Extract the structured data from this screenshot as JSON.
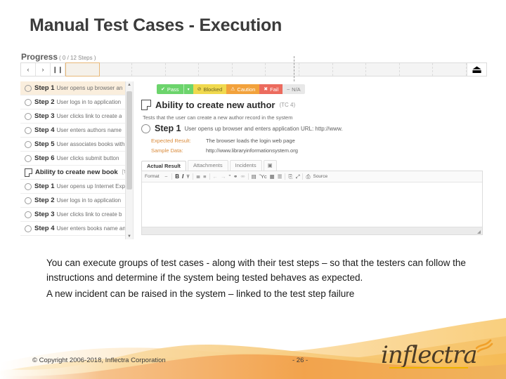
{
  "slide": {
    "title": "Manual Test Cases - Execution"
  },
  "screenshot": {
    "progress": {
      "label": "Progress",
      "sublabel": "( 0 / 12 Steps )",
      "prev_icon": "‹",
      "next_icon": "›",
      "pause_icon": "❙❙",
      "eject_icon": "⏏"
    },
    "tree": {
      "scroll_up_icon": "▲",
      "scroll_down_icon": "▼",
      "rows": [
        {
          "type": "step",
          "num": "Step 1",
          "desc": "User opens up browser an",
          "selected": true
        },
        {
          "type": "step",
          "num": "Step 2",
          "desc": "User logs in to application",
          "selected": false
        },
        {
          "type": "step",
          "num": "Step 3",
          "desc": "User clicks link to create a",
          "selected": false
        },
        {
          "type": "step",
          "num": "Step 4",
          "desc": "User enters authors name",
          "selected": false
        },
        {
          "type": "step",
          "num": "Step 5",
          "desc": "User associates books with",
          "selected": false
        },
        {
          "type": "step",
          "num": "Step 6",
          "desc": "User clicks submit button",
          "selected": false
        },
        {
          "type": "testcase",
          "num": "Ability to create new book",
          "desc": "",
          "tag": "[T",
          "selected": false
        },
        {
          "type": "step",
          "num": "Step 1",
          "desc": "User opens up Internet Exp",
          "selected": false
        },
        {
          "type": "step",
          "num": "Step 2",
          "desc": "User logs in to application",
          "selected": false
        },
        {
          "type": "step",
          "num": "Step 3",
          "desc": "User clicks link to create b",
          "selected": false
        },
        {
          "type": "step",
          "num": "Step 4",
          "desc": "User enters books name an",
          "selected": false
        }
      ]
    },
    "statuses": [
      {
        "label": "Pass",
        "icon": "✔",
        "cls": "st-pass"
      },
      {
        "label": "Blocked",
        "icon": "⊘",
        "cls": "st-blocked"
      },
      {
        "label": "Caution",
        "icon": "⚠",
        "cls": "st-caution"
      },
      {
        "label": "Fail",
        "icon": "✖",
        "cls": "st-fail"
      },
      {
        "label": "N/A",
        "icon": "–",
        "cls": "st-na"
      }
    ],
    "status_caret": "▾",
    "testcase": {
      "title": "Ability to create new author",
      "id": "(TC 4)",
      "description": "Tests that the user can create a new author record in the system"
    },
    "step": {
      "number": "Step 1",
      "text": "User opens up browser and enters application URL: http://www.",
      "expected_key": "Expected Result:",
      "expected_val": "The browser loads the login web page",
      "sample_key": "Sample Data:",
      "sample_val": "http://www.libraryinformationsystem.org"
    },
    "tabs": [
      {
        "label": "Actual Result",
        "active": true,
        "icon": false
      },
      {
        "label": "Attachments",
        "active": false,
        "icon": false
      },
      {
        "label": "Incidents",
        "active": false,
        "icon": false
      },
      {
        "label": "▣",
        "active": false,
        "icon": true
      }
    ],
    "editor": {
      "format_label": "Format",
      "format_caret": "–",
      "bold": "B",
      "italic": "I",
      "strike": "Ŧ",
      "ordered_list": "≣",
      "bullet_list": "≡",
      "outdent": "←",
      "indent": "→",
      "quote": "”",
      "link": "⚭",
      "unlink": "⚮",
      "image": "Ὓc",
      "flash": "▤",
      "table": "▦",
      "hr": "☰",
      "paste": "⎘",
      "maximize": "⤢",
      "source_icon": "⎙",
      "source_label": "Source"
    }
  },
  "body": {
    "paragraph1": "You can execute groups of test cases - along with their test steps – so that the testers can follow the instructions and determine if the system being tested behaves as expected.",
    "paragraph2": "A new incident can be raised in the system – linked to the test step failure"
  },
  "footer": {
    "copyright": "© Copyright 2006-2018, Inflectra Corporation",
    "page": "- 26 -",
    "logo_text": "inflectra"
  },
  "colors": {
    "accent_orange": "#f0a02a",
    "pass_green": "#6cd46c",
    "fail_red": "#ec6b5e",
    "title_gray": "#3b3b3b"
  }
}
